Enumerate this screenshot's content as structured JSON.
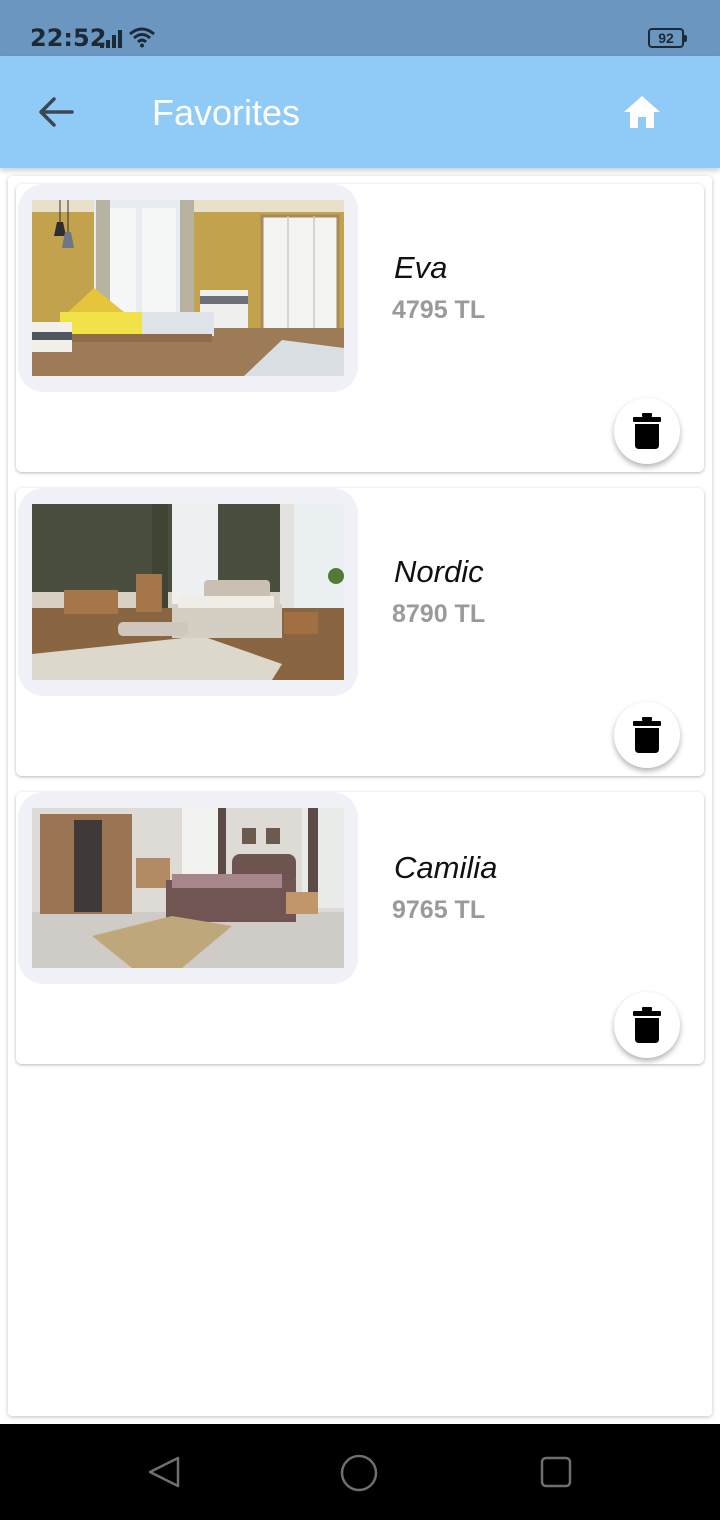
{
  "status_bar": {
    "time": "22:52",
    "battery": "92"
  },
  "app_bar": {
    "title": "Favorites"
  },
  "items": [
    {
      "name": "Eva",
      "price": "4795 TL"
    },
    {
      "name": "Nordic",
      "price": "8790 TL"
    },
    {
      "name": "Camilia",
      "price": "9765 TL"
    }
  ],
  "colors": {
    "app_bar": "#90caf7",
    "status_bar": "#6b96c0",
    "price": "#9a9a9a",
    "thumb_frame": "#eff1f6"
  },
  "icons": {
    "back": "arrow-left-icon",
    "home": "home-icon",
    "delete": "trash-icon"
  }
}
